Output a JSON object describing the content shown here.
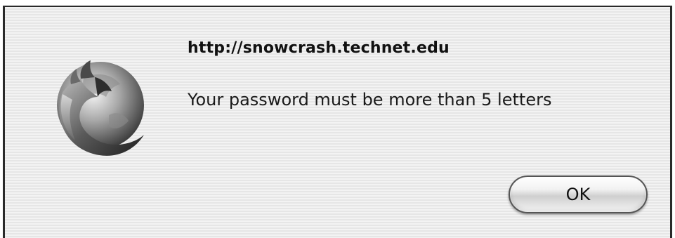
{
  "dialog": {
    "title": "http://snowcrash.technet.edu",
    "message": "Your password must be more than 5 letters",
    "icon": "firefox-icon",
    "ok_label": "OK"
  }
}
